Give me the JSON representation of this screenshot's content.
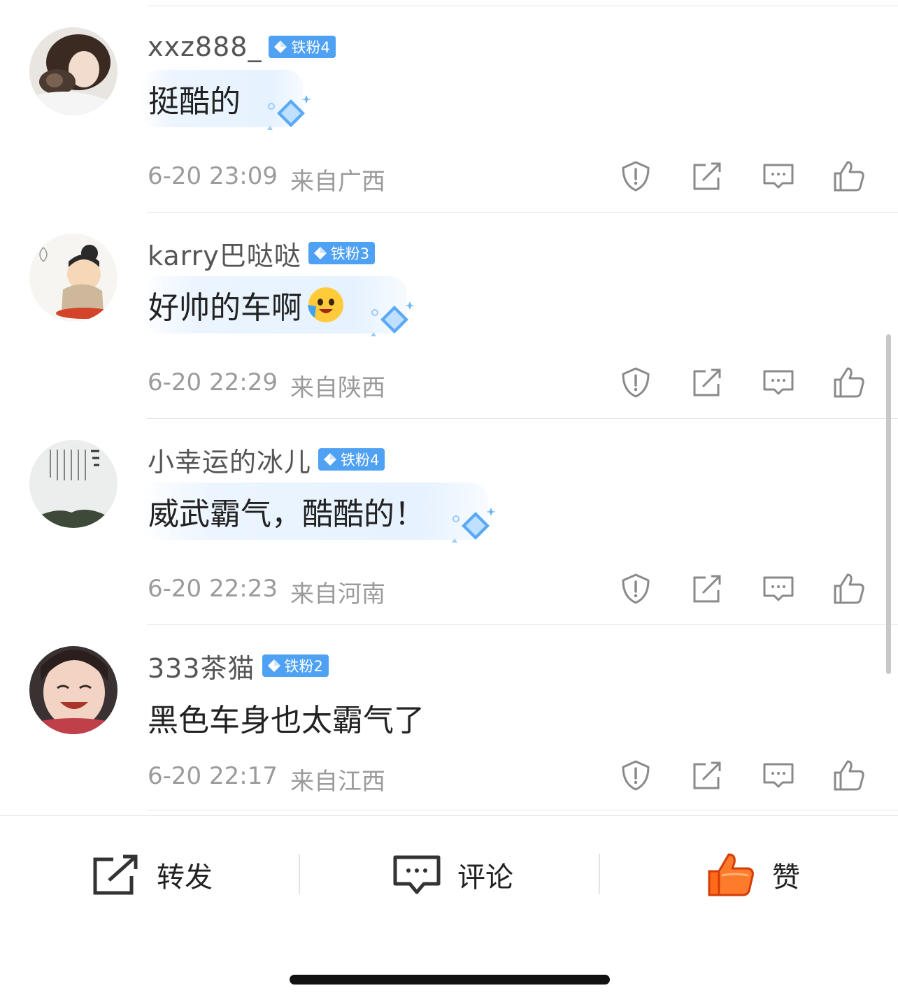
{
  "comments": [
    {
      "username": "xxz888_",
      "badge": "铁粉4",
      "text": "挺酷的",
      "time": "6-20 23:09",
      "location": "来自广西",
      "has_bubble": true,
      "avatar": "avatar-girl-with-cat"
    },
    {
      "username": "karry巴哒哒",
      "badge": "铁粉3",
      "text": "好帅的车啊",
      "emoji": "laughing-crying-emoji",
      "time": "6-20 22:29",
      "location": "来自陕西",
      "has_bubble": true,
      "avatar": "avatar-cartoon-monk"
    },
    {
      "username": "小幸运的冰儿",
      "badge": "铁粉4",
      "text": "威武霸气，酷酷的！",
      "time": "6-20 22:23",
      "location": "来自河南",
      "has_bubble": true,
      "avatar": "avatar-calligraphy"
    },
    {
      "username": "333茶猫",
      "badge": "铁粉2",
      "text": "黑色车身也太霸气了",
      "time": "6-20 22:17",
      "location": "来自江西",
      "has_bubble": false,
      "avatar": "avatar-smiling-child"
    }
  ],
  "comment_actions": [
    "report-icon",
    "share-icon",
    "reply-icon",
    "like-icon"
  ],
  "bottom_bar": {
    "repost": "转发",
    "comment": "评论",
    "like": "赞"
  },
  "colors": {
    "badge": "#4ea1f3",
    "like_active": "#ff6a1a",
    "meta_text": "#9b9b9b",
    "icon": "#8a8a8a"
  }
}
